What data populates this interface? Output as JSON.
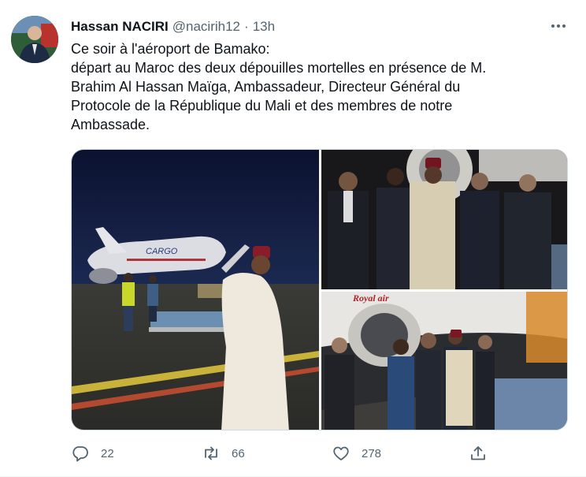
{
  "tweet": {
    "author_name": "Hassan NACIRI",
    "author_handle": "@nacirih12",
    "separator": "·",
    "time": "13h",
    "text_lines": [
      "Ce soir à l'aéroport de Bamako:",
      "départ au Maroc des  deux dépouilles mortelles en présence de M.",
      "Brahim Al Hassan Maïga, Ambassadeur, Directeur Général du",
      "Protocole de la République du Mali et des membres de notre",
      "Ambassade."
    ],
    "photo_texts": {
      "cargo_label": "CARGO",
      "plane_label": "Royal air"
    },
    "actions": {
      "replies": "22",
      "retweets": "66",
      "likes": "278"
    }
  },
  "icons": {
    "reply": "reply-icon",
    "retweet": "retweet-icon",
    "like": "heart-icon",
    "share": "share-icon",
    "more": "more-icon"
  },
  "colors": {
    "secondary_text": "#536471",
    "primary_text": "#0f1419",
    "border": "#cfd9de"
  }
}
